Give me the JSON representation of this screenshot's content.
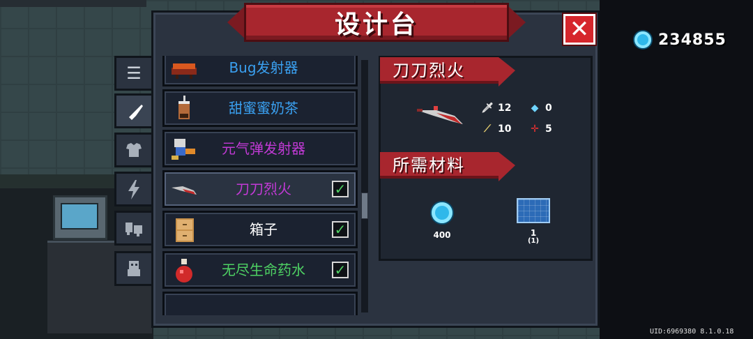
{
  "title": "设计台",
  "close_label": "✕",
  "currency": {
    "value": "234855",
    "icon": "gem-icon",
    "color": "#2fb8ea"
  },
  "side_tabs": [
    {
      "name": "list",
      "icon": "list-icon",
      "glyph": "☰"
    },
    {
      "name": "weapon",
      "icon": "weapon-icon",
      "glyph": "⚔",
      "active": true
    },
    {
      "name": "armor",
      "icon": "armor-icon",
      "glyph": "👕"
    },
    {
      "name": "skill",
      "icon": "lightning-icon",
      "glyph": "⚡"
    },
    {
      "name": "pet",
      "icon": "pet-icon",
      "glyph": "🐾"
    },
    {
      "name": "character",
      "icon": "character-icon",
      "glyph": "☺"
    }
  ],
  "items": [
    {
      "name": "Bug发射器",
      "color": "#3aa0f0",
      "checked": false
    },
    {
      "name": "甜蜜蜜奶茶",
      "color": "#3aa0f0",
      "checked": false
    },
    {
      "name": "元气弹发射器",
      "color": "#c23ad6",
      "checked": false
    },
    {
      "name": "刀刀烈火",
      "color": "#c23ad6",
      "checked": true,
      "selected": true
    },
    {
      "name": "箱子",
      "color": "#ffffff",
      "checked": true
    },
    {
      "name": "无尽生命药水",
      "color": "#4ed163",
      "checked": true
    }
  ],
  "detail": {
    "name": "刀刀烈火",
    "stats": {
      "damage": "12",
      "energy": "0",
      "critical": "10",
      "accuracy": "5"
    },
    "materials_label": "所需材料",
    "materials": [
      {
        "icon": "gem-icon",
        "amount": "400"
      },
      {
        "icon": "blueprint-icon",
        "amount": "1",
        "owned": "(1)"
      }
    ]
  },
  "uid": "UID:6969380 8.1.0.18"
}
